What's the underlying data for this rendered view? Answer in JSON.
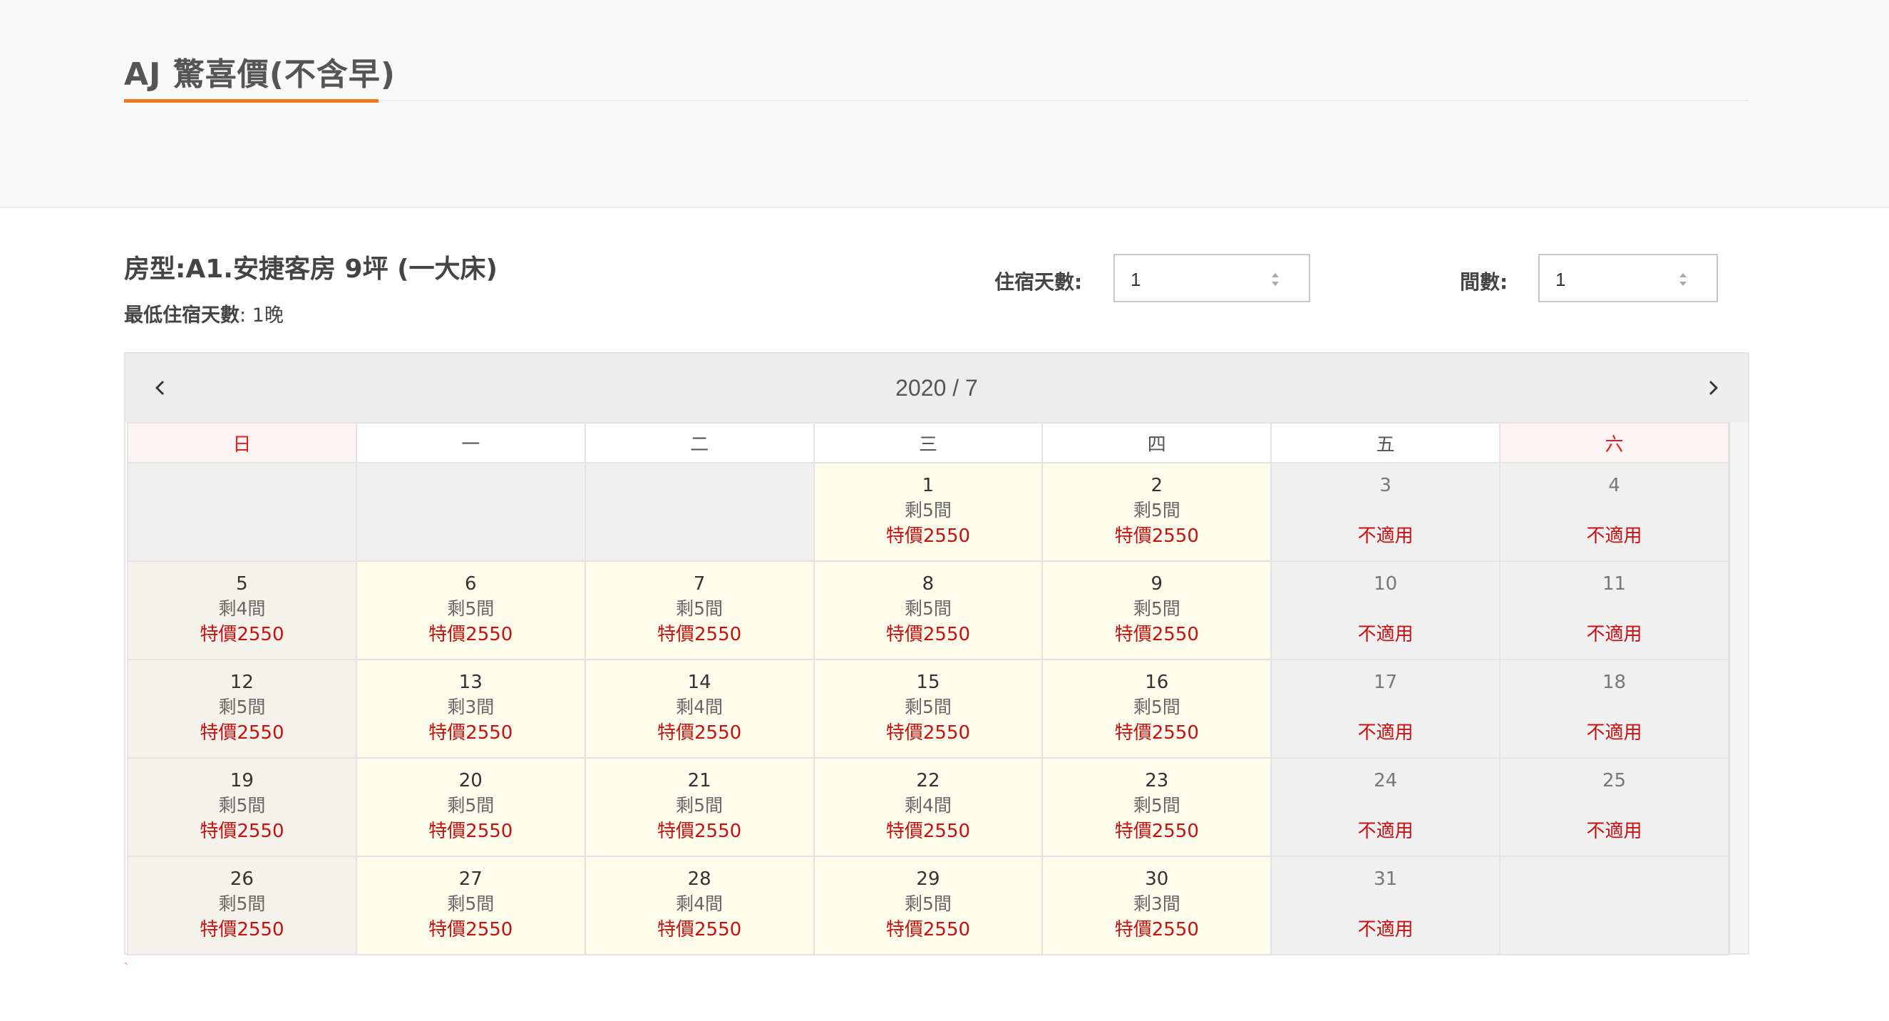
{
  "header": {
    "title": "AJ 驚喜價(不含早)"
  },
  "room": {
    "type_label": "房型:A1.安捷客房 9坪 (一大床)",
    "min_stay_label": "最低住宿天數",
    "min_stay_value": ": 1晚"
  },
  "controls": {
    "nights_label": "住宿天數:",
    "nights_value": "1",
    "rooms_label": "間數:",
    "rooms_value": "1"
  },
  "calendar": {
    "month": "2020 / 7",
    "weekdays": [
      "日",
      "一",
      "二",
      "三",
      "四",
      "五",
      "六"
    ],
    "weeks": [
      [
        {
          "status": "blank"
        },
        {
          "status": "blank"
        },
        {
          "status": "blank"
        },
        {
          "day": "1",
          "status": "avail",
          "rooms": "剩5間",
          "price": "特價2550"
        },
        {
          "day": "2",
          "status": "avail",
          "rooms": "剩5間",
          "price": "特價2550"
        },
        {
          "day": "3",
          "status": "na",
          "note": "不適用"
        },
        {
          "day": "4",
          "status": "na",
          "note": "不適用"
        }
      ],
      [
        {
          "day": "5",
          "status": "sun-avail",
          "rooms": "剩4間",
          "price": "特價2550"
        },
        {
          "day": "6",
          "status": "avail",
          "rooms": "剩5間",
          "price": "特價2550"
        },
        {
          "day": "7",
          "status": "avail",
          "rooms": "剩5間",
          "price": "特價2550"
        },
        {
          "day": "8",
          "status": "avail",
          "rooms": "剩5間",
          "price": "特價2550"
        },
        {
          "day": "9",
          "status": "avail",
          "rooms": "剩5間",
          "price": "特價2550"
        },
        {
          "day": "10",
          "status": "na",
          "note": "不適用"
        },
        {
          "day": "11",
          "status": "na",
          "note": "不適用"
        }
      ],
      [
        {
          "day": "12",
          "status": "sun-avail",
          "rooms": "剩5間",
          "price": "特價2550"
        },
        {
          "day": "13",
          "status": "avail",
          "rooms": "剩3間",
          "price": "特價2550"
        },
        {
          "day": "14",
          "status": "avail",
          "rooms": "剩4間",
          "price": "特價2550"
        },
        {
          "day": "15",
          "status": "avail",
          "rooms": "剩5間",
          "price": "特價2550"
        },
        {
          "day": "16",
          "status": "avail",
          "rooms": "剩5間",
          "price": "特價2550"
        },
        {
          "day": "17",
          "status": "na",
          "note": "不適用"
        },
        {
          "day": "18",
          "status": "na",
          "note": "不適用"
        }
      ],
      [
        {
          "day": "19",
          "status": "sun-avail",
          "rooms": "剩5間",
          "price": "特價2550"
        },
        {
          "day": "20",
          "status": "avail",
          "rooms": "剩5間",
          "price": "特價2550"
        },
        {
          "day": "21",
          "status": "avail",
          "rooms": "剩5間",
          "price": "特價2550"
        },
        {
          "day": "22",
          "status": "avail",
          "rooms": "剩4間",
          "price": "特價2550"
        },
        {
          "day": "23",
          "status": "avail",
          "rooms": "剩5間",
          "price": "特價2550"
        },
        {
          "day": "24",
          "status": "na",
          "note": "不適用"
        },
        {
          "day": "25",
          "status": "na",
          "note": "不適用"
        }
      ],
      [
        {
          "day": "26",
          "status": "sun-avail",
          "rooms": "剩5間",
          "price": "特價2550"
        },
        {
          "day": "27",
          "status": "avail",
          "rooms": "剩5間",
          "price": "特價2550"
        },
        {
          "day": "28",
          "status": "avail",
          "rooms": "剩4間",
          "price": "特價2550"
        },
        {
          "day": "29",
          "status": "avail",
          "rooms": "剩5間",
          "price": "特價2550"
        },
        {
          "day": "30",
          "status": "avail",
          "rooms": "剩3間",
          "price": "特價2550"
        },
        {
          "day": "31",
          "status": "na",
          "note": "不適用"
        },
        {
          "status": "blank"
        }
      ]
    ]
  },
  "footer_mark": "`",
  "colors": {
    "accent": "#ec7a1f",
    "price_red": "#c81010",
    "available_bg": "#fefdec",
    "unavailable_bg": "#f0f0f0"
  },
  "icons": {
    "prev": "chevron-left-icon",
    "next": "chevron-right-icon",
    "spinner": "stepper-arrows-icon"
  }
}
